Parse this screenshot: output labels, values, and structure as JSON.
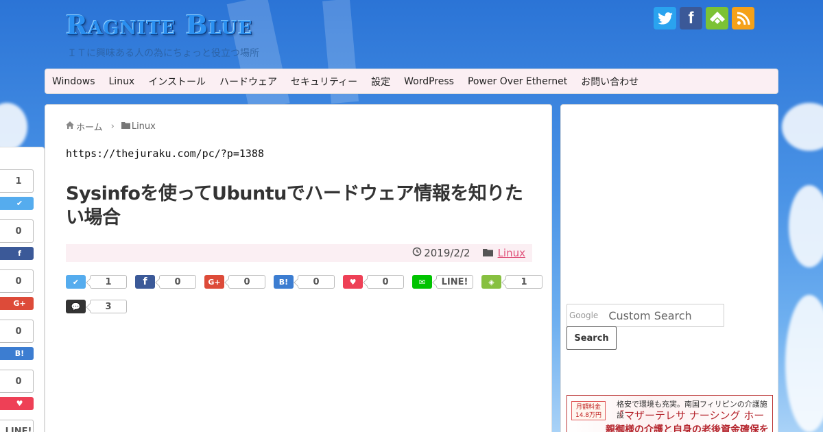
{
  "site": {
    "title": "Ragnite Blue",
    "tagline": "ＩＴに興味ある人の為にちょっと役立つ場所"
  },
  "social": [
    {
      "name": "twitter",
      "glyph": "🐦"
    },
    {
      "name": "facebook",
      "glyph": "f"
    },
    {
      "name": "feedly",
      "glyph": "◈"
    },
    {
      "name": "rss",
      "glyph": "☉"
    }
  ],
  "nav": {
    "items": [
      "Windows",
      "Linux",
      "インストール",
      "ハードウェア",
      "セキュリティー",
      "設定",
      "WordPress",
      "Power Over Ethernet",
      "お問い合わせ"
    ]
  },
  "breadcrumb": {
    "home": "ホーム",
    "category": "Linux"
  },
  "post": {
    "url": "https://thejuraku.com/pc/?p=1388",
    "title": "Sysinfoを使ってUbuntuでハードウェア情報を知りたい場合",
    "date": "2019/2/2",
    "category": "Linux"
  },
  "share": {
    "twitter": {
      "icon": "twitter-icon",
      "count": "1",
      "glyph": "✔"
    },
    "facebook": {
      "icon": "facebook-icon",
      "count": "0",
      "glyph": "f"
    },
    "googleplus": {
      "icon": "google-plus-icon",
      "count": "0",
      "glyph": "G+"
    },
    "hatena": {
      "icon": "hatena-bookmark-icon",
      "count": "0",
      "glyph": "B!"
    },
    "pocket": {
      "icon": "pocket-icon",
      "count": "0",
      "glyph": "♥"
    },
    "line": {
      "icon": "line-icon",
      "count": "LINE!",
      "glyph": "✉"
    },
    "feedly": {
      "icon": "feedly-icon",
      "count": "1",
      "glyph": "◈"
    },
    "comments": {
      "icon": "comment-icon",
      "count": "3",
      "glyph": "💬"
    }
  },
  "left_share": {
    "twitter_count": "1",
    "facebook_count": "0",
    "googleplus_count": "0",
    "hatena_count": "0",
    "pocket_count": "0",
    "line_label": "LINE!"
  },
  "sidebar": {
    "search_logo": "Google",
    "search_placeholder": "Custom Search",
    "search_button": "Search",
    "ad": {
      "badge": "月額料金 14.8万円",
      "line1": "格安で環境も充実。南国フィリピンの介護施設",
      "line2": "「マザーテレサ ナーシング ホーム」",
      "line3": "親御様の介護と自身の老後資金確保を"
    }
  },
  "colors": {
    "accent_pink": "#e0527a",
    "nav_bg": "#fbeff3",
    "title_blue": "#2a8ff0"
  }
}
